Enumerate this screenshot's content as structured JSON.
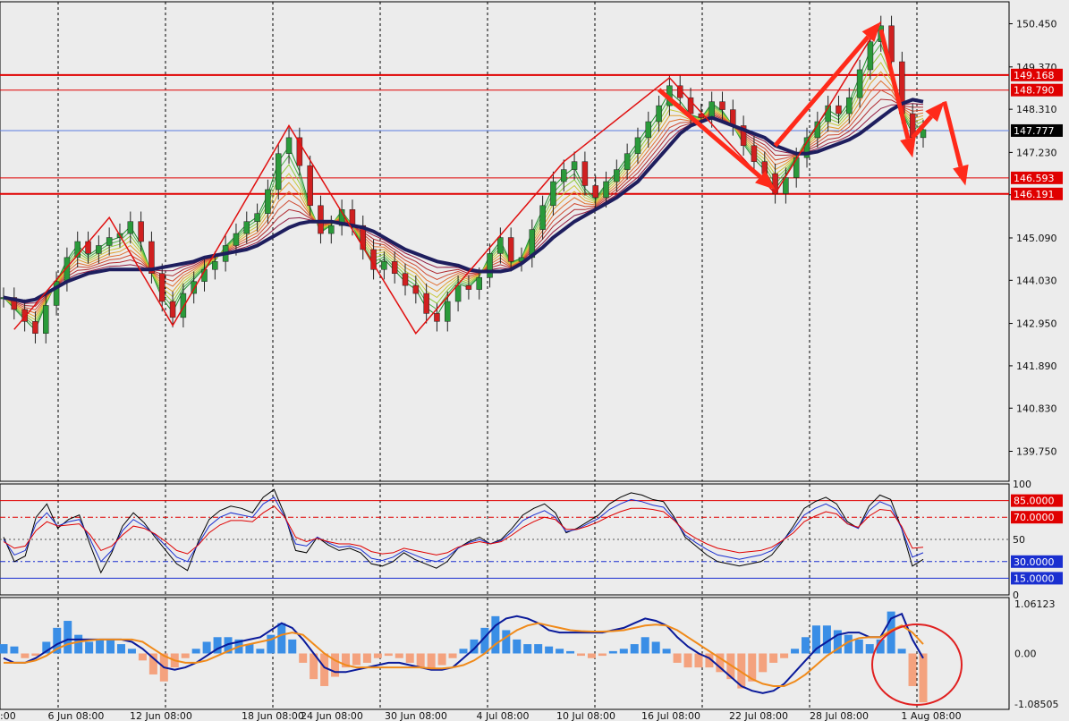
{
  "chart_data": [
    {
      "type": "line",
      "panel": "price",
      "title": "",
      "xlabel": "",
      "ylabel": "",
      "ylim": [
        139.0,
        151.0
      ],
      "y_ticks": [
        "150.450",
        "149.370",
        "148.310",
        "147.230",
        "146.170",
        "145.090",
        "144.030",
        "142.950",
        "141.890",
        "140.830",
        "139.750"
      ],
      "y_tick_values": [
        150.45,
        149.37,
        148.31,
        147.23,
        146.17,
        145.09,
        144.03,
        142.95,
        141.89,
        140.83,
        139.75
      ],
      "x_ticks": [
        "6 Jun 08:00",
        "12 Jun 08:00",
        "18 Jun 08:00",
        "24 Jun 08:00",
        "30 Jun 08:00",
        "4 Jul 08:00",
        "10 Jul 08:00",
        "16 Jul 08:00",
        "22 Jul 08:00",
        "28 Jul 08:00",
        "1 Aug 08:00"
      ],
      "first_tick_partial": ":00",
      "horizontal_levels": [
        {
          "label": "149.168",
          "value": 149.168,
          "color": "#e00000",
          "style": "thick"
        },
        {
          "label": "148.790",
          "value": 148.79,
          "color": "#e00000",
          "style": "thin"
        },
        {
          "label": "147.777",
          "value": 147.777,
          "color": "#000000",
          "style": "current"
        },
        {
          "label": "146.593",
          "value": 146.593,
          "color": "#e00000",
          "style": "thin"
        },
        {
          "label": "146.191",
          "value": 146.191,
          "color": "#e00000",
          "style": "thick"
        }
      ],
      "current_line_color": "#5a7de0",
      "price_series": [
        143.6,
        143.3,
        143.0,
        142.7,
        143.4,
        144.0,
        144.6,
        145.0,
        144.7,
        144.9,
        145.1,
        145.2,
        145.5,
        145.0,
        144.2,
        143.5,
        143.1,
        143.7,
        144.0,
        144.3,
        144.5,
        144.9,
        145.2,
        145.5,
        145.7,
        146.3,
        147.2,
        147.6,
        146.9,
        145.9,
        145.2,
        145.4,
        145.8,
        145.4,
        144.8,
        144.3,
        144.5,
        144.2,
        143.9,
        143.7,
        143.2,
        143.0,
        143.5,
        143.9,
        143.8,
        144.1,
        144.7,
        145.1,
        144.5,
        144.6,
        145.3,
        145.9,
        146.5,
        146.8,
        147.0,
        146.4,
        146.1,
        146.5,
        146.8,
        147.2,
        147.6,
        148.0,
        148.4,
        148.9,
        148.6,
        148.2,
        148.1,
        148.5,
        148.3,
        147.9,
        147.4,
        147.0,
        146.7,
        146.2,
        146.6,
        147.1,
        147.6,
        148.0,
        148.4,
        148.2,
        148.6,
        149.3,
        150.0,
        150.4,
        149.5,
        148.2,
        147.6,
        147.8
      ],
      "ema_series": [
        143.6,
        143.55,
        143.5,
        143.55,
        143.7,
        143.85,
        144.0,
        144.1,
        144.2,
        144.25,
        144.3,
        144.3,
        144.3,
        144.3,
        144.3,
        144.35,
        144.4,
        144.45,
        144.5,
        144.6,
        144.65,
        144.7,
        144.75,
        144.8,
        144.9,
        145.05,
        145.2,
        145.35,
        145.45,
        145.5,
        145.5,
        145.5,
        145.45,
        145.4,
        145.35,
        145.25,
        145.1,
        144.95,
        144.8,
        144.7,
        144.6,
        144.5,
        144.45,
        144.4,
        144.3,
        144.25,
        144.25,
        144.25,
        144.3,
        144.45,
        144.65,
        144.85,
        145.1,
        145.3,
        145.5,
        145.65,
        145.8,
        145.95,
        146.1,
        146.3,
        146.5,
        146.8,
        147.1,
        147.4,
        147.7,
        147.9,
        148.0,
        148.1,
        148.0,
        147.9,
        147.8,
        147.7,
        147.6,
        147.4,
        147.3,
        147.2,
        147.2,
        147.25,
        147.35,
        147.45,
        147.55,
        147.7,
        147.9,
        148.1,
        148.3,
        148.45,
        148.55,
        148.5
      ],
      "zigzag_points": [
        {
          "i": 1,
          "v": 142.8
        },
        {
          "i": 10,
          "v": 145.6
        },
        {
          "i": 16,
          "v": 142.9
        },
        {
          "i": 27,
          "v": 147.9
        },
        {
          "i": 39,
          "v": 142.7
        },
        {
          "i": 53,
          "v": 147.0
        },
        {
          "i": 63,
          "v": 149.1
        },
        {
          "i": 73,
          "v": 146.2
        },
        {
          "i": 83,
          "v": 150.5
        }
      ],
      "arrow_color": "#ff2a1a",
      "arrows": [
        {
          "from_i": 62,
          "from_v": 148.8,
          "to_i": 73,
          "to_v": 146.3
        },
        {
          "from_i": 73,
          "from_v": 147.4,
          "to_i": 83,
          "to_v": 150.5
        },
        {
          "from_i": 83,
          "from_v": 150.3,
          "to_i": 86,
          "to_v": 147.1
        },
        {
          "from_i": 86,
          "from_v": 147.6,
          "to_i": 89,
          "to_v": 148.5
        },
        {
          "from_i": 89,
          "from_v": 148.5,
          "to_i": 91,
          "to_v": 146.4
        }
      ]
    },
    {
      "type": "line",
      "panel": "oscillator",
      "title": "",
      "ylim": [
        0,
        100
      ],
      "y_ticks": [
        "100",
        "50",
        "0"
      ],
      "y_tick_values": [
        100,
        50,
        0
      ],
      "levels": [
        {
          "label": "85.0000",
          "value": 85,
          "color": "#e00000",
          "style": "solid",
          "boxed": true
        },
        {
          "label": "70.0000",
          "value": 70,
          "color": "#e00000",
          "style": "dashdot",
          "boxed": true
        },
        {
          "label": "30.0000",
          "value": 30,
          "color": "#1a2fd0",
          "style": "dashdot",
          "boxed": true
        },
        {
          "label": "15.0000",
          "value": 15,
          "color": "#1a2fd0",
          "style": "solid",
          "boxed": true
        }
      ],
      "series": [
        {
          "color": "#000000",
          "values": [
            52,
            30,
            35,
            70,
            82,
            60,
            68,
            72,
            45,
            20,
            38,
            62,
            74,
            65,
            52,
            40,
            28,
            22,
            48,
            68,
            76,
            80,
            78,
            74,
            88,
            95,
            72,
            40,
            38,
            52,
            45,
            40,
            42,
            38,
            28,
            26,
            30,
            38,
            32,
            28,
            24,
            30,
            42,
            48,
            52,
            46,
            50,
            60,
            72,
            78,
            82,
            74,
            56,
            60,
            66,
            72,
            82,
            88,
            92,
            90,
            86,
            84,
            70,
            52,
            44,
            36,
            30,
            28,
            26,
            28,
            30,
            36,
            48,
            62,
            78,
            84,
            88,
            82,
            66,
            60,
            80,
            90,
            86,
            60,
            26,
            32
          ]
        },
        {
          "color": "#1a2fd0",
          "values": [
            50,
            36,
            40,
            64,
            74,
            62,
            66,
            68,
            50,
            30,
            40,
            58,
            68,
            62,
            54,
            44,
            34,
            30,
            46,
            62,
            70,
            74,
            72,
            70,
            82,
            88,
            70,
            46,
            44,
            52,
            47,
            43,
            44,
            41,
            33,
            31,
            34,
            40,
            36,
            32,
            30,
            34,
            42,
            47,
            50,
            46,
            49,
            57,
            67,
            72,
            76,
            70,
            57,
            59,
            64,
            69,
            77,
            82,
            86,
            84,
            81,
            79,
            68,
            54,
            47,
            41,
            36,
            34,
            32,
            34,
            36,
            40,
            49,
            59,
            72,
            78,
            82,
            77,
            64,
            60,
            76,
            84,
            80,
            60,
            34,
            38
          ]
        },
        {
          "color": "#e00000",
          "values": [
            48,
            42,
            44,
            58,
            66,
            62,
            63,
            64,
            54,
            40,
            44,
            54,
            62,
            60,
            55,
            48,
            40,
            37,
            45,
            56,
            63,
            67,
            67,
            66,
            74,
            80,
            70,
            52,
            48,
            51,
            48,
            46,
            46,
            44,
            39,
            37,
            38,
            42,
            40,
            38,
            36,
            38,
            43,
            46,
            48,
            46,
            48,
            54,
            61,
            66,
            70,
            68,
            59,
            59,
            62,
            66,
            71,
            75,
            78,
            78,
            77,
            75,
            67,
            57,
            51,
            46,
            42,
            40,
            38,
            39,
            40,
            43,
            49,
            56,
            66,
            71,
            75,
            73,
            64,
            61,
            71,
            77,
            76,
            62,
            42,
            43
          ]
        }
      ]
    },
    {
      "type": "bar",
      "panel": "macd",
      "title": "",
      "ylim": [
        -1.2,
        1.2
      ],
      "y_ticks": [
        "1.06123",
        "0.00",
        "-1.08505"
      ],
      "y_tick_values": [
        1.06123,
        0.0,
        -1.08505
      ],
      "bar_positive_color": "#3a8ee6",
      "bar_negative_color": "#f4a27e",
      "histogram": [
        0.2,
        0.15,
        -0.1,
        -0.05,
        0.25,
        0.55,
        0.7,
        0.4,
        0.25,
        0.3,
        0.3,
        0.2,
        0.1,
        -0.15,
        -0.45,
        -0.6,
        -0.3,
        -0.1,
        0.1,
        0.25,
        0.35,
        0.35,
        0.3,
        0.2,
        0.1,
        0.4,
        0.65,
        0.3,
        -0.2,
        -0.55,
        -0.7,
        -0.5,
        -0.3,
        -0.25,
        -0.2,
        -0.1,
        -0.05,
        -0.1,
        -0.2,
        -0.3,
        -0.35,
        -0.25,
        -0.1,
        0.1,
        0.3,
        0.55,
        0.8,
        0.5,
        0.3,
        0.2,
        0.2,
        0.15,
        0.1,
        0.05,
        -0.05,
        -0.1,
        -0.05,
        0.05,
        0.1,
        0.2,
        0.35,
        0.25,
        0.1,
        -0.2,
        -0.3,
        -0.3,
        -0.3,
        -0.4,
        -0.55,
        -0.75,
        -0.6,
        -0.4,
        -0.2,
        -0.1,
        0.1,
        0.35,
        0.6,
        0.6,
        0.5,
        0.4,
        0.3,
        0.2,
        0.3,
        0.9,
        0.1,
        -0.7,
        -1.05
      ],
      "series": [
        {
          "color": "#0a1a9a",
          "values": [
            -0.1,
            -0.2,
            -0.2,
            -0.1,
            0.05,
            0.2,
            0.3,
            0.3,
            0.3,
            0.3,
            0.3,
            0.3,
            0.25,
            0.1,
            -0.1,
            -0.3,
            -0.35,
            -0.3,
            -0.2,
            -0.05,
            0.1,
            0.2,
            0.25,
            0.3,
            0.35,
            0.5,
            0.65,
            0.55,
            0.3,
            0.0,
            -0.3,
            -0.4,
            -0.4,
            -0.35,
            -0.3,
            -0.25,
            -0.2,
            -0.2,
            -0.25,
            -0.3,
            -0.35,
            -0.35,
            -0.3,
            -0.1,
            0.1,
            0.35,
            0.6,
            0.75,
            0.8,
            0.75,
            0.65,
            0.5,
            0.45,
            0.45,
            0.45,
            0.45,
            0.45,
            0.5,
            0.55,
            0.65,
            0.75,
            0.7,
            0.6,
            0.35,
            0.15,
            0.0,
            -0.1,
            -0.3,
            -0.5,
            -0.7,
            -0.8,
            -0.85,
            -0.8,
            -0.65,
            -0.4,
            -0.15,
            0.1,
            0.25,
            0.4,
            0.45,
            0.45,
            0.35,
            0.35,
            0.75,
            0.85,
            0.3,
            -0.1
          ]
        },
        {
          "color": "#f08a1a",
          "values": [
            -0.2,
            -0.2,
            -0.2,
            -0.15,
            -0.05,
            0.1,
            0.2,
            0.25,
            0.28,
            0.3,
            0.3,
            0.3,
            0.3,
            0.25,
            0.1,
            -0.05,
            -0.15,
            -0.2,
            -0.2,
            -0.15,
            -0.05,
            0.05,
            0.15,
            0.2,
            0.25,
            0.3,
            0.4,
            0.45,
            0.4,
            0.2,
            0.0,
            -0.15,
            -0.25,
            -0.3,
            -0.3,
            -0.3,
            -0.3,
            -0.3,
            -0.3,
            -0.3,
            -0.32,
            -0.32,
            -0.3,
            -0.25,
            -0.15,
            0.0,
            0.2,
            0.35,
            0.5,
            0.6,
            0.65,
            0.6,
            0.55,
            0.5,
            0.48,
            0.47,
            0.47,
            0.48,
            0.5,
            0.55,
            0.6,
            0.62,
            0.6,
            0.5,
            0.35,
            0.2,
            0.05,
            -0.1,
            -0.25,
            -0.4,
            -0.55,
            -0.65,
            -0.7,
            -0.7,
            -0.6,
            -0.45,
            -0.25,
            -0.05,
            0.1,
            0.25,
            0.33,
            0.35,
            0.35,
            0.5,
            0.6,
            0.45,
            0.2
          ]
        }
      ],
      "highlight_circle_color": "#e02020"
    }
  ]
}
